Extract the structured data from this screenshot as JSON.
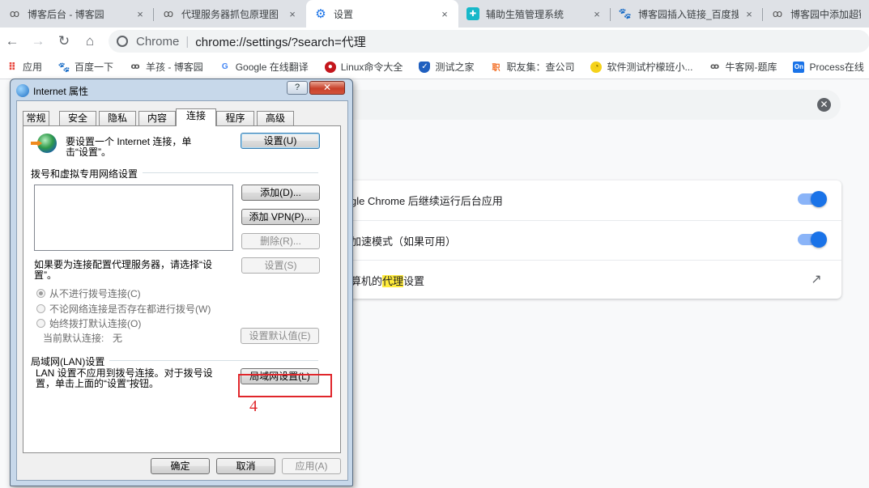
{
  "browser": {
    "tabs": [
      {
        "title": "博客后台 - 博客园",
        "icon": "cnblogs-icon",
        "active": false
      },
      {
        "title": "代理服务器抓包原理图",
        "icon": "cnblogs-icon",
        "active": false
      },
      {
        "title": "设置",
        "icon": "settings-gear-icon",
        "active": true
      },
      {
        "title": "辅助生殖管理系统",
        "icon": "app-icon",
        "active": false
      },
      {
        "title": "博客园插入链接_百度搜",
        "icon": "baidu-icon",
        "active": false
      },
      {
        "title": "博客园中添加超链接",
        "icon": "cnblogs-icon",
        "active": false
      }
    ],
    "tab_close": "×",
    "omnibox": {
      "site_label": "Chrome",
      "url": "chrome://settings/?search=代理"
    },
    "bookmarks": [
      {
        "label": "应用",
        "icon": "apps-grid-icon"
      },
      {
        "label": "百度一下",
        "icon": "baidu-icon"
      },
      {
        "label": "羊孩 - 博客园",
        "icon": "cnblogs-icon"
      },
      {
        "label": "Google 在线翻译",
        "icon": "google-icon"
      },
      {
        "label": "Linux命令大全",
        "icon": "linux-icon"
      },
      {
        "label": "测试之家",
        "icon": "shield-icon"
      },
      {
        "label": "职友集：查公司",
        "icon": "jobui-icon"
      },
      {
        "label": "软件测试柠檬班小...",
        "icon": "lemon-icon"
      },
      {
        "label": "牛客网-题库",
        "icon": "nowcoder-icon"
      },
      {
        "label": "Process在线",
        "icon": "processon-icon"
      }
    ]
  },
  "settings": {
    "rows": [
      {
        "text_before": "gle Chrome 后继续运行后台应用",
        "highlight": "",
        "text_after": "",
        "control": "toggle",
        "on": true
      },
      {
        "text_before": "加速模式（如果可用）",
        "highlight": "",
        "text_after": "",
        "control": "toggle",
        "on": true
      },
      {
        "text_before": "算机的",
        "highlight": "代理",
        "text_after": "设置",
        "control": "external-link"
      }
    ]
  },
  "dialog": {
    "title": "Internet 属性",
    "help_label": "?",
    "close_label": "✕",
    "tabs": [
      "常规",
      "安全",
      "隐私",
      "内容",
      "连接",
      "程序",
      "高级"
    ],
    "active_tab": "连接",
    "setup_text": "要设置一个 Internet 连接，单击“设置”。",
    "setup_button": "设置(U)",
    "dialup_header": "拨号和虚拟专用网络设置",
    "add_button": "添加(D)...",
    "add_vpn_button": "添加 VPN(P)...",
    "remove_button": "删除(R)...",
    "proxy_text": "如果要为连接配置代理服务器，请选择“设置”。",
    "proxy_settings_button": "设置(S)",
    "radio_options": [
      {
        "label": "从不进行拨号连接(C)",
        "selected": true
      },
      {
        "label": "不论网络连接是否存在都进行拨号(W)",
        "selected": false
      },
      {
        "label": "始终拨打默认连接(O)",
        "selected": false
      }
    ],
    "current_default_label": "当前默认连接:",
    "current_default_value": "无",
    "set_default_button": "设置默认值(E)",
    "lan_header": "局域网(LAN)设置",
    "lan_text": "LAN 设置不应用到拨号连接。对于拨号设置，单击上面的“设置”按钮。",
    "lan_button": "局域网设置(L)",
    "ok_button": "确定",
    "cancel_button": "取消",
    "apply_button": "应用(A)"
  },
  "annotation": {
    "label": "4",
    "color": "#e0262b"
  }
}
